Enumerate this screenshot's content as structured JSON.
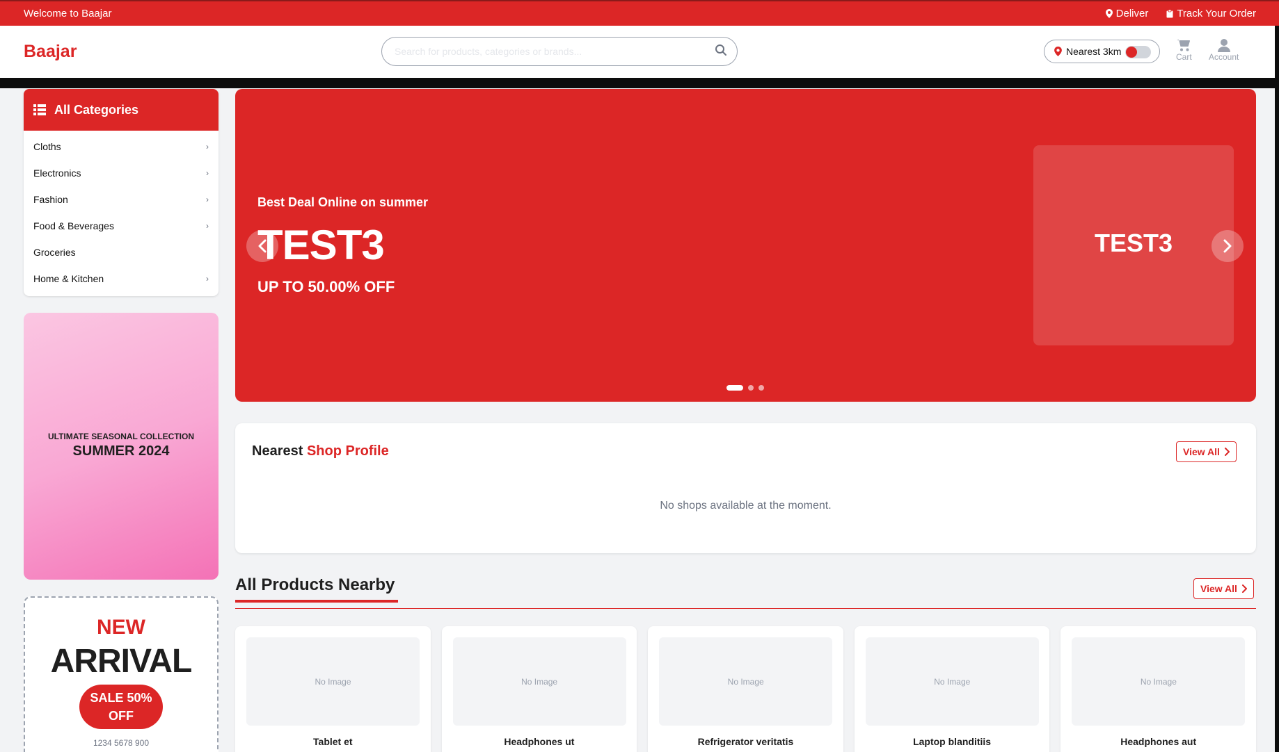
{
  "topbar": {
    "welcome": "Welcome to Baajar",
    "deliver": "Deliver",
    "track_order": "Track Your Order"
  },
  "header": {
    "logo": "Baajar",
    "search_placeholder": "Search for products, categories or brands...",
    "nearest_label": "Nearest 3km",
    "nearest_toggle_on": false,
    "cart_label": "Cart",
    "account_label": "Account"
  },
  "categories": {
    "title": "All Categories",
    "items": [
      {
        "label": "Cloths",
        "has_sub": true
      },
      {
        "label": "Electronics",
        "has_sub": true
      },
      {
        "label": "Fashion",
        "has_sub": true
      },
      {
        "label": "Food & Beverages",
        "has_sub": true
      },
      {
        "label": "Groceries",
        "has_sub": false
      },
      {
        "label": "Home & Kitchen",
        "has_sub": true
      }
    ]
  },
  "summer_promo": {
    "small": "ULTIMATE SEASONAL COLLECTION",
    "big": "SUMMER 2024"
  },
  "arrival_promo": {
    "new": "NEW",
    "arrival": "ARRIVAL",
    "sale": "SALE 50% OFF",
    "phone": "1234 5678 900"
  },
  "hero": {
    "subtitle": "Best Deal Online on summer",
    "title": "TEST3",
    "offer": "UP TO 50.00% OFF",
    "panel_text": "TEST3",
    "slide_count": 3,
    "active_slide": 1
  },
  "nearest_shop": {
    "title_plain": "Nearest",
    "title_accent": "Shop Profile",
    "view_all": "View All",
    "empty_message": "No shops available at the moment."
  },
  "products": {
    "title": "All Products Nearby",
    "view_all": "View All",
    "no_image": "No Image",
    "items": [
      {
        "name": "Tablet et"
      },
      {
        "name": "Headphones ut"
      },
      {
        "name": "Refrigerator veritatis"
      },
      {
        "name": "Laptop blanditiis"
      },
      {
        "name": "Headphones aut"
      }
    ]
  },
  "colors": {
    "brand_red": "#dc2626",
    "page_bg": "#f2f3f5"
  }
}
